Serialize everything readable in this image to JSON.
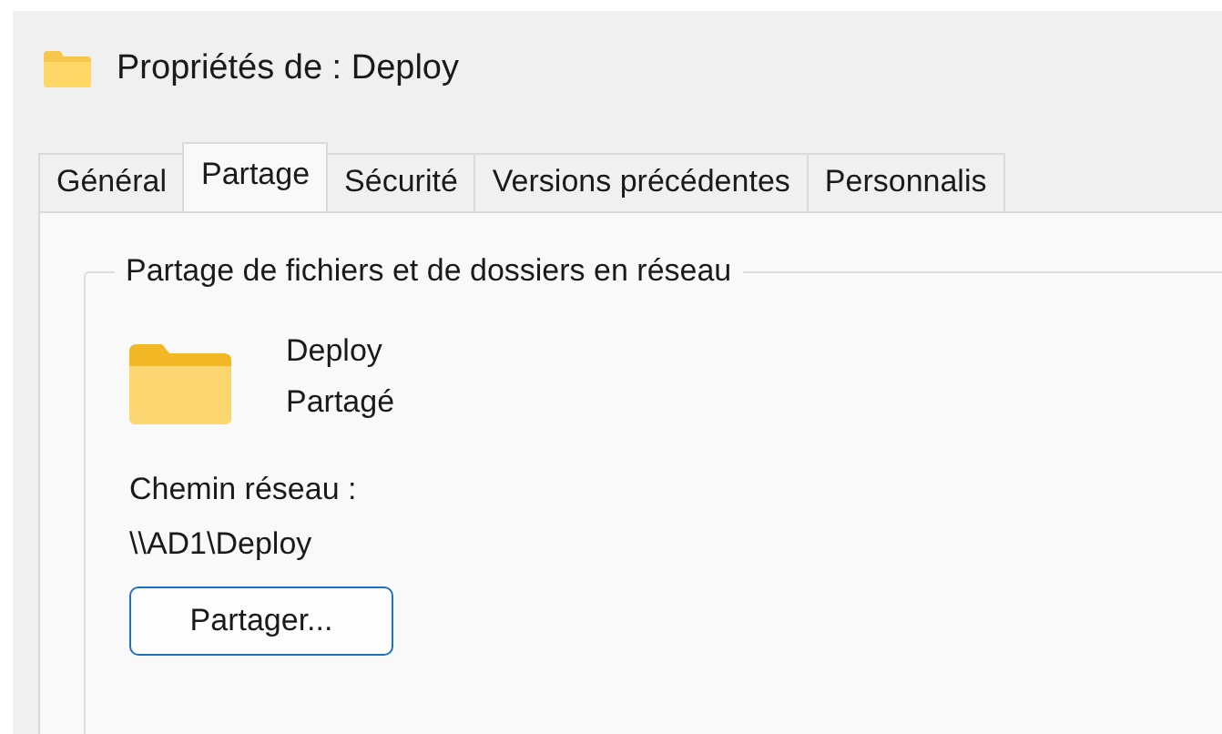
{
  "window": {
    "title": "Propriétés de : Deploy"
  },
  "tabs": [
    {
      "label": "Général",
      "selected": false
    },
    {
      "label": "Partage",
      "selected": true
    },
    {
      "label": "Sécurité",
      "selected": false
    },
    {
      "label": "Versions précédentes",
      "selected": false
    },
    {
      "label": "Personnalis",
      "selected": false
    }
  ],
  "group": {
    "title": "Partage de fichiers et de dossiers en réseau",
    "folder_name": "Deploy",
    "folder_status": "Partagé",
    "path_label": "Chemin réseau :",
    "path": "\\\\AD1\\Deploy",
    "button": "Partager..."
  }
}
